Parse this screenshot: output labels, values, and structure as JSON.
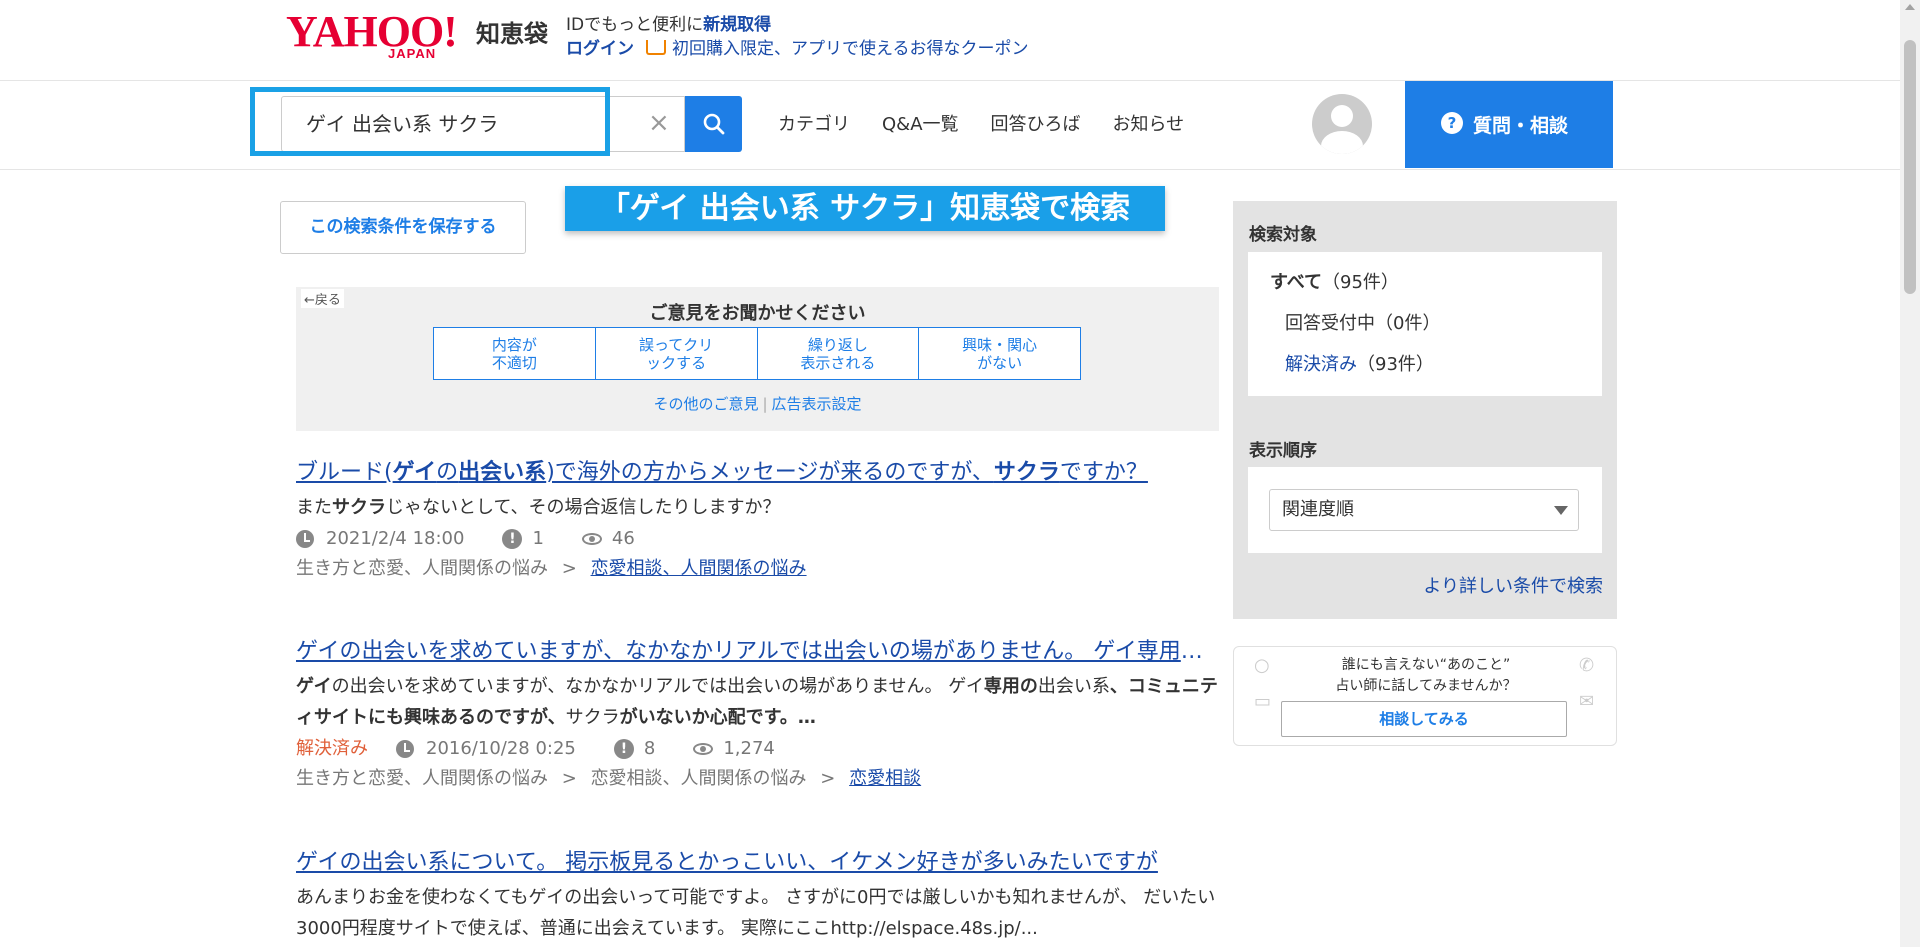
{
  "header": {
    "logo_yahoo": "YAHOO!",
    "logo_japan": "JAPAN",
    "logo_service": "知恵袋",
    "promo_line1_prefix": "IDでもっと便利に",
    "promo_line1_link": "新規取得",
    "login": "ログイン",
    "coupon": "初回購入限定、アプリで使えるお得なクーポン"
  },
  "search": {
    "query": "ゲイ 出会い系 サクラ",
    "clear": "×"
  },
  "nav": {
    "items": [
      "カテゴリ",
      "Q&A一覧",
      "回答ひろば",
      "お知らせ"
    ],
    "ask_button": "質問・相談"
  },
  "save_condition": "この検索条件を保存する",
  "search_banner": "「ゲイ 出会い系 サクラ」知恵袋で検索",
  "feedback": {
    "back": "←戻る",
    "title": "ご意見をお聞かせください",
    "options": [
      "内容が\n不適切",
      "誤ってクリ\nックする",
      "繰り返し\n表示される",
      "興味・関心\nがない"
    ],
    "other": "その他のご意見",
    "ad_settings": "広告表示設定"
  },
  "results": [
    {
      "title_parts": [
        "ブルード(",
        "ゲイ",
        "の",
        "出会い系",
        ")で海外の方からメッセージが来るのですが、",
        "サクラ",
        "ですか？"
      ],
      "snippet_parts": [
        "また",
        "サクラ",
        "じゃないとして、その場合返信したりしますか？"
      ],
      "solved": "",
      "date": "2021/2/4 18:00",
      "answers": "1",
      "views": "46",
      "category_path": "生き方と恋愛、人間関係の悩み",
      "sep": ">",
      "category_link": "恋愛相談、人間関係の悩み"
    },
    {
      "title": "ゲイの出会いを求めていますが、なかなかリアルでは出会いの場がありません。 ゲイ専用の出会い系",
      "snippet_parts": [
        "ゲイ",
        "の出会いを求めていますが、なかなかリアルでは出会いの場がありません。 ",
        "ゲイ",
        "専用の",
        "出会い系",
        "、コミュニティサイトにも興味あるのですが、",
        "サクラ",
        "がいないか心配です。…"
      ],
      "solved": "解決済み",
      "date": "2016/10/28 0:25",
      "answers": "8",
      "views": "1,274",
      "category_path": "生き方と恋愛、人間関係の悩み",
      "category_path2": "恋愛相談、人間関係の悩み",
      "sep": ">",
      "category_link": "恋愛相談"
    },
    {
      "title": "ゲイの出会い系について。 掲示板見るとかっこいい、イケメン好きが多いみたいですが",
      "snippet": "あんまりお金を使わなくてもゲイの出会いって可能ですよ。 さすがに0円では厳しいかも知れませんが、 だいたい3000円程度サイトで使えば、普通に出会えています。 実際にここhttp://elspace.48s.jp/..."
    }
  ],
  "sidebar": {
    "target_heading": "検索対象",
    "target_all": "すべて",
    "target_all_count": "（95件）",
    "target_open": "回答受付中（0件）",
    "target_solved": "解決済み",
    "target_solved_count": "（93件）",
    "order_heading": "表示順序",
    "order_selected": "関連度順",
    "more_conditions": "より詳しい条件で検索"
  },
  "fortune": {
    "line1": "誰にも言えない“あのこと”",
    "line2": "占い師に話してみませんか？",
    "button": "相談してみる"
  },
  "colors": {
    "brand_red": "#e60033",
    "link_blue": "#1a4ba8",
    "accent_blue": "#1e7ee6",
    "banner_blue": "#1a9fe8",
    "solved_orange": "#e0603a"
  }
}
